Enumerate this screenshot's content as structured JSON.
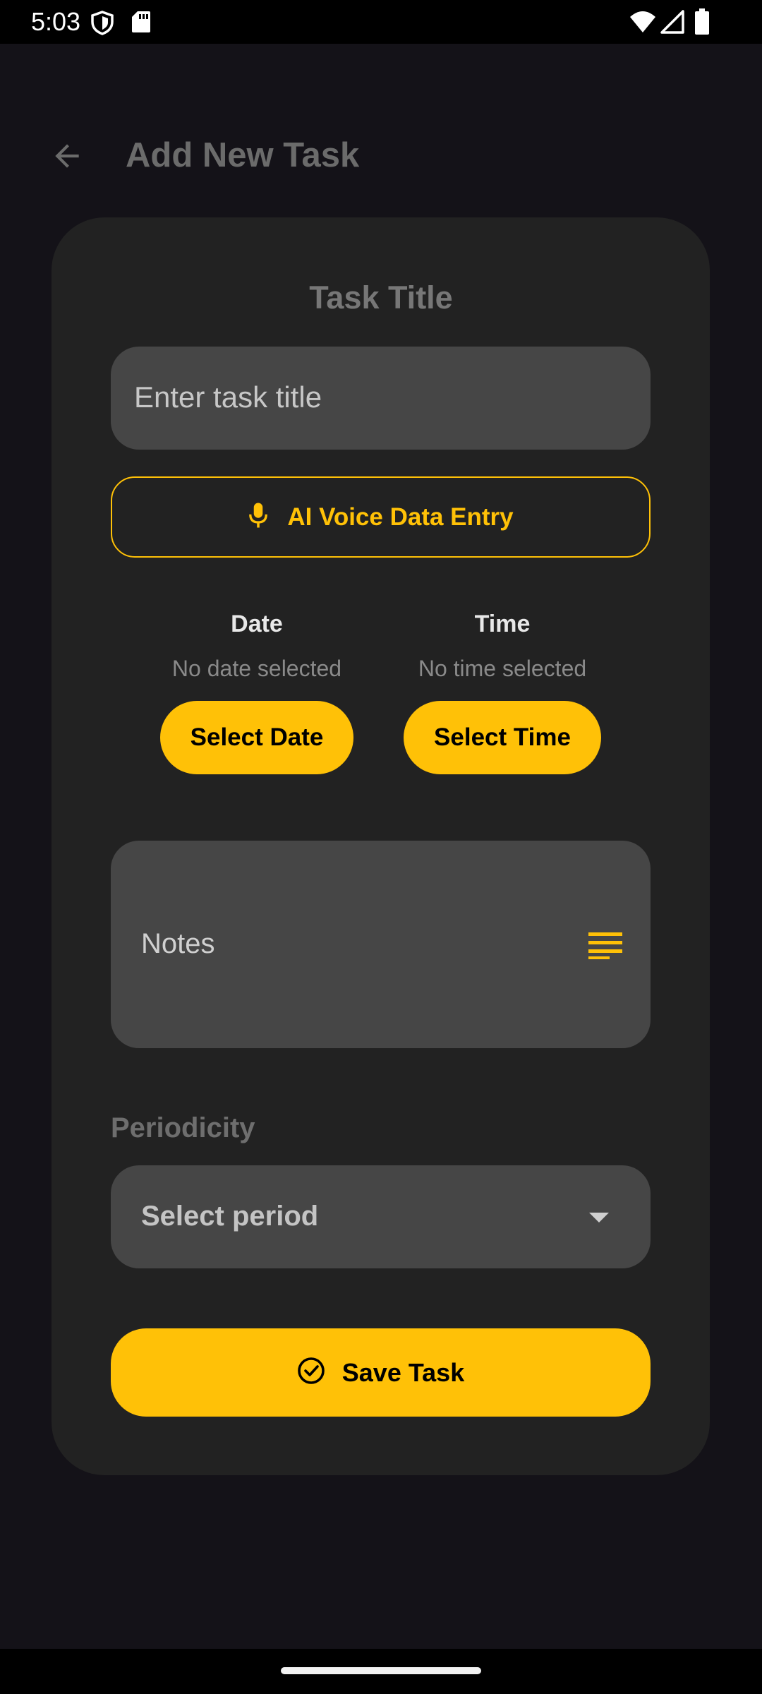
{
  "status_bar": {
    "time": "5:03",
    "icons": [
      "shield-icon",
      "sd-card-icon",
      "wifi-icon",
      "signal-icon",
      "battery-icon"
    ]
  },
  "app_bar": {
    "back_icon": "arrow-back-icon",
    "title": "Add New Task"
  },
  "form": {
    "task_title_label": "Task Title",
    "task_title_placeholder": "Enter task title",
    "voice_button": {
      "icon": "mic-icon",
      "label": "AI Voice Data Entry"
    },
    "date": {
      "heading": "Date",
      "value": "No date selected",
      "button": "Select Date"
    },
    "time": {
      "heading": "Time",
      "value": "No time selected",
      "button": "Select Time"
    },
    "notes": {
      "label": "Notes",
      "icon": "notes-lines-icon"
    },
    "periodicity": {
      "label": "Periodicity",
      "value": "Select period",
      "icon": "dropdown-caret-icon"
    },
    "save_button": {
      "icon": "check-circle-icon",
      "label": "Save Task"
    }
  },
  "colors": {
    "accent": "#ffc107",
    "background": "#141218",
    "card": "#222222",
    "field": "#464646"
  }
}
